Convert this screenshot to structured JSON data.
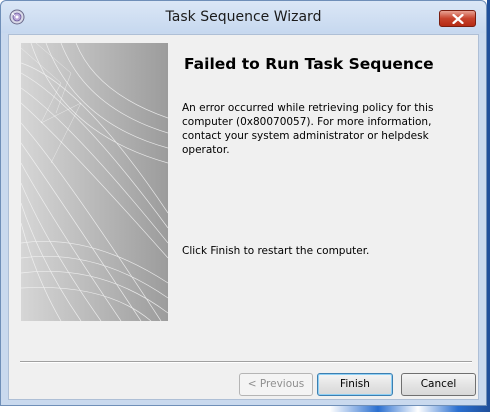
{
  "window": {
    "title": "Task Sequence Wizard",
    "app_icon": "setup-disc-icon",
    "close_icon": "close-icon"
  },
  "content": {
    "heading": "Failed to Run Task Sequence",
    "message": "An error occurred while retrieving policy for this computer (0x80070057). For more information, contact your system administrator or helpdesk operator.",
    "restart_note": "Click Finish to restart the computer."
  },
  "buttons": {
    "previous": "< Previous",
    "finish": "Finish",
    "cancel": "Cancel"
  },
  "colors": {
    "close_button": "#c7432d",
    "title_bar": "#c6d8ef",
    "dialog_background": "#f0f0f0"
  }
}
